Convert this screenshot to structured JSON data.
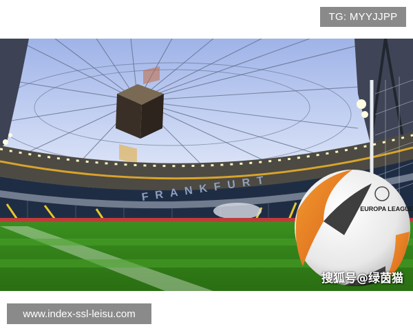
{
  "top_badge": {
    "text": "TG: MYYJJPP"
  },
  "photo": {
    "scene": "stadium-interior",
    "stadium_lettering": "FRANKFURT",
    "ball": {
      "brand_text": "EUROPA LEAGUE"
    },
    "watermark": "搜狐号@绿茵猫"
  },
  "bottom_badge": {
    "text": "www.index-ssl-leisu.com"
  }
}
